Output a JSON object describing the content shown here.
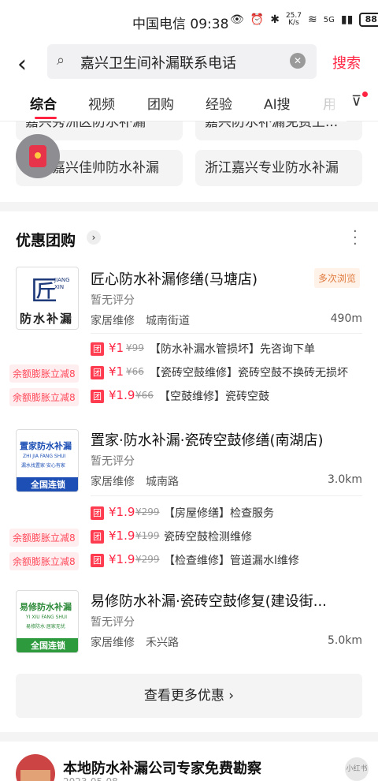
{
  "status_bar": {
    "carrier_time": "中国电信 09:38",
    "net_speed": "25.7\nK/s",
    "network": "5G",
    "battery": "88"
  },
  "search": {
    "query": "嘉兴卫生间补漏联系电话",
    "submit_label": "搜索"
  },
  "tabs": [
    {
      "label": "综合",
      "active": true
    },
    {
      "label": "视频"
    },
    {
      "label": "团购"
    },
    {
      "label": "经验"
    },
    {
      "label": "AI搜"
    },
    {
      "label": "用"
    }
  ],
  "related": {
    "partial_left": "嘉兴秀洲区防水补漏",
    "partial_right": "嘉兴防水补漏免费上...",
    "chip_left": "上海嘉兴佳帅防水补漏",
    "chip_right": "浙江嘉兴专业防水补漏"
  },
  "deals_section": {
    "title": "优惠团购",
    "shops": [
      {
        "name": "匠心防水补漏修缮(马塘店)",
        "badge": "多次浏览",
        "rating": "暂无评分",
        "category": "家居维修",
        "area": "城南街道",
        "distance": "490m",
        "logo_text": "防水补漏",
        "logo_big": "匠",
        "logo_sub": "JIANG XIN",
        "deals": [
          {
            "promo": "",
            "tag": "团",
            "price": "¥1",
            "orig": "¥99",
            "desc": "【防水补漏水管损坏】先咨询下单"
          },
          {
            "promo": "余额膨胀立减8",
            "tag": "团",
            "price": "¥1",
            "orig": "¥66",
            "desc": "【瓷砖空鼓维修】瓷砖空鼓不换砖无损坏"
          },
          {
            "promo": "余额膨胀立减8",
            "tag": "团",
            "price": "¥1.9",
            "orig": "¥66",
            "desc": "【空鼓维修】瓷砖空鼓"
          }
        ]
      },
      {
        "name": "置家·防水补漏·瓷砖空鼓修缮(南湖店)",
        "rating": "暂无评分",
        "category": "家居维修",
        "area": "城南路",
        "distance": "3.0km",
        "logo_title": "置家防水补漏",
        "logo_pinyin": "ZHI JIA FANG SHUI",
        "logo_slogan": "漏水找置家·安心有家",
        "logo_chain": "全国连锁",
        "deals": [
          {
            "promo": "",
            "tag": "团",
            "price": "¥1.9",
            "orig": "¥299",
            "desc": "【房屋修缮】检查服务"
          },
          {
            "promo": "余额膨胀立减8",
            "tag": "团",
            "price": "¥1.9",
            "orig": "¥199",
            "desc": "瓷砖空鼓检测维修"
          },
          {
            "promo": "余额膨胀立减8",
            "tag": "团",
            "price": "¥1.9",
            "orig": "¥299",
            "desc": "【检查维修】管道漏水l维修"
          }
        ]
      },
      {
        "name": "易修防水补漏·瓷砖空鼓修复(建设街...",
        "rating": "暂无评分",
        "category": "家居维修",
        "area": "禾兴路",
        "distance": "5.0km",
        "logo_title": "易修防水补漏",
        "logo_pinyin": "YI XIU FANG SHUI",
        "logo_slogan": "易修防水·居家无忧",
        "logo_chain": "全国连锁"
      }
    ],
    "more_label": "查看更多优惠 ›"
  },
  "bottom_card": {
    "title": "本地防水补漏公司专家免费勘察",
    "subtitle": "2023-05-08",
    "watermark": "小红书"
  }
}
